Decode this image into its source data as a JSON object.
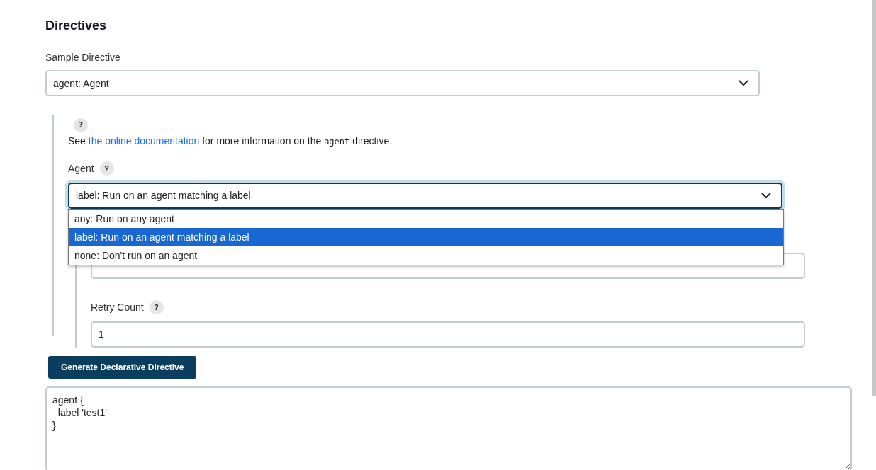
{
  "heading": "Directives",
  "sample_directive": {
    "label": "Sample Directive",
    "value": "agent: Agent"
  },
  "section": {
    "help_icon": "?",
    "help_text": {
      "before": "See ",
      "link": "the online documentation",
      "middle": " for more information on the ",
      "code": "agent",
      "after": " directive."
    },
    "agent": {
      "label": "Agent",
      "help_icon": "?",
      "value": "label: Run on an agent matching a label",
      "expanded": true,
      "options": [
        {
          "label": "any: Run on any agent",
          "selected": false
        },
        {
          "label": "label: Run on an agent matching a label",
          "selected": true
        },
        {
          "label": "none: Don't run on an agent",
          "selected": false
        }
      ]
    },
    "retry": {
      "label": "Retry Count",
      "help_icon": "?",
      "value": "1"
    }
  },
  "generate_button": "Generate Declarative Directive",
  "output_lines": [
    "agent {",
    "  label 'test1'",
    "}"
  ]
}
